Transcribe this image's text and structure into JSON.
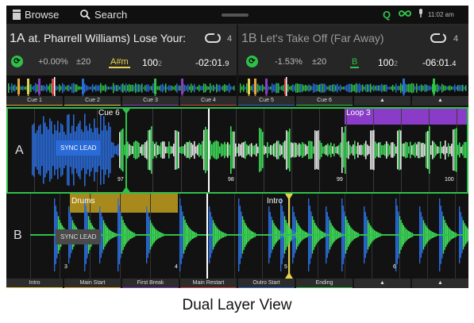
{
  "topbar": {
    "browse_label": "Browse",
    "search_label": "Search",
    "q_label": "Q",
    "clock": "11:02 am",
    "accent": "#2fc04a"
  },
  "deckA": {
    "number": "1A",
    "title": "at. Pharrell Williams)  Lose Your:",
    "loop_count": "4",
    "sync_label": "⟳",
    "pitch": "+0.00%",
    "pitch_range": "±20",
    "key": "A#m",
    "bpm": "100",
    "bpm_decimal": "2",
    "time": "-02:01",
    "time_decimal": "9"
  },
  "deckB": {
    "number": "1B",
    "title": "Let's Take Off (Far Away)",
    "loop_count": "4",
    "sync_label": "⟳",
    "pitch": "-1.53%",
    "pitch_range": "±20",
    "key": "B",
    "bpm": "100",
    "bpm_decimal": "2",
    "time": "-06:01",
    "time_decimal": "4"
  },
  "cues_top": [
    {
      "label": "Cue 1",
      "color": "#e8a63a"
    },
    {
      "label": "Cue 2",
      "color": "#e8d24c"
    },
    {
      "label": "Cue 3",
      "color": "#8a3cc8"
    },
    {
      "label": "Cue 4",
      "color": "#d84040"
    },
    {
      "label": "Cue 5",
      "color": "#2a6bd8"
    },
    {
      "label": "Cue 6",
      "color": "#2fc04a"
    },
    {
      "label": "▲",
      "color": "#2c2c2c"
    },
    {
      "label": "▲",
      "color": "#2c2c2c"
    }
  ],
  "cues_bottom": [
    {
      "label": "Intro",
      "color": "#e8d24c"
    },
    {
      "label": "Main Start",
      "color": "#e8a63a"
    },
    {
      "label": "First Break",
      "color": "#8a3cc8"
    },
    {
      "label": "Main Restart",
      "color": "#d84040"
    },
    {
      "label": "Outro Start",
      "color": "#2a6bd8"
    },
    {
      "label": "Ending",
      "color": "#2fc04a"
    },
    {
      "label": "▲",
      "color": "#2c2c2c"
    },
    {
      "label": "▲",
      "color": "#2c2c2c"
    }
  ],
  "waveA": {
    "letter": "A",
    "sync_lead": "SYNC LEAD",
    "cue_label": "Cue 6",
    "loop_label": "Loop 3",
    "beats": [
      "97",
      "98",
      "99",
      "100"
    ]
  },
  "waveB": {
    "letter": "B",
    "sync_lead": "SYNC LEAD",
    "drums_label": "Drums",
    "intro_label": "Intro",
    "beats": [
      "3",
      "4",
      "5",
      "6"
    ]
  },
  "caption": "Dual Layer View"
}
